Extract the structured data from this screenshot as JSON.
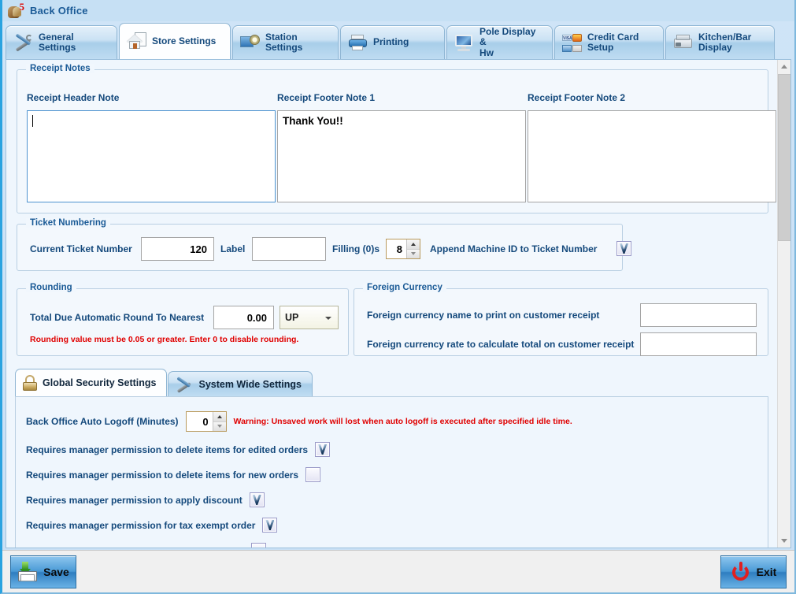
{
  "window": {
    "title": "Back Office",
    "logo_icon": "back-office-logo-icon"
  },
  "tabs": [
    {
      "label": "General\nSettings",
      "icon": "wrench-screwdriver-icon",
      "active": false
    },
    {
      "label": "Store Settings",
      "icon": "home-icon",
      "active": true
    },
    {
      "label": "Station Settings",
      "icon": "station-gear-icon",
      "active": false
    },
    {
      "label": "Printing",
      "icon": "printer-icon",
      "active": false
    },
    {
      "label": "Pole Display &\nHw",
      "icon": "monitor-icon",
      "active": false
    },
    {
      "label": "Credit Card\nSetup",
      "icon": "credit-cards-icon",
      "active": false
    },
    {
      "label": "Kitchen/Bar\nDisplay",
      "icon": "kitchen-printer-icon",
      "active": false
    }
  ],
  "receipt_notes": {
    "caption": "Receipt Notes",
    "header_note_label": "Receipt Header Note",
    "header_note_value": "",
    "footer_note_1_label": "Receipt Footer Note 1",
    "footer_note_1_value": "Thank You!!",
    "footer_note_2_label": "Receipt Footer Note 2",
    "footer_note_2_value": ""
  },
  "ticket_numbering": {
    "caption": "Ticket Numbering",
    "current_ticket_number_label": "Current Ticket Number",
    "current_ticket_number_value": "120",
    "label_label": "Label",
    "label_value": "",
    "filling_label": "Filling (0)s",
    "filling_value": "8",
    "append_machine_id_label": "Append Machine ID to Ticket Number",
    "append_machine_id_checked": true
  },
  "rounding": {
    "caption": "Rounding",
    "round_to_nearest_label": "Total Due Automatic Round To Nearest",
    "round_to_nearest_value": "0.00",
    "direction_value": "UP",
    "direction_options": [
      "UP",
      "DOWN"
    ],
    "warning": "Rounding value must be 0.05 or greater. Enter 0 to disable rounding."
  },
  "foreign_currency": {
    "caption": "Foreign Currency",
    "name_label": "Foreign currency name to print on customer receipt",
    "name_value": "",
    "rate_label": "Foreign currency rate to calculate total on customer receipt",
    "rate_value": ""
  },
  "inner_tabs": [
    {
      "label": "Global Security Settings",
      "icon": "padlock-icon",
      "active": true
    },
    {
      "label": "System Wide Settings",
      "icon": "wrench-screwdriver-icon",
      "active": false
    }
  ],
  "security_settings": {
    "auto_logoff_label": "Back Office Auto Logoff (Minutes)",
    "auto_logoff_value": "0",
    "auto_logoff_warning": "Warning: Unsaved work will lost when auto logoff is executed after specified idle time.",
    "rows": [
      {
        "label": "Requires manager permission to delete items for edited orders",
        "checked": true
      },
      {
        "label": "Requires manager permission to delete items for new orders",
        "checked": false
      },
      {
        "label": "Requires manager permission to apply discount",
        "checked": true
      },
      {
        "label": "Requires manager permission for tax exempt order",
        "checked": true
      }
    ]
  },
  "footer": {
    "save_label": "Save",
    "exit_label": "Exit"
  },
  "colors": {
    "accent": "#1a5a96",
    "warning": "#e00000",
    "window_bg": "#cfe4f7"
  }
}
